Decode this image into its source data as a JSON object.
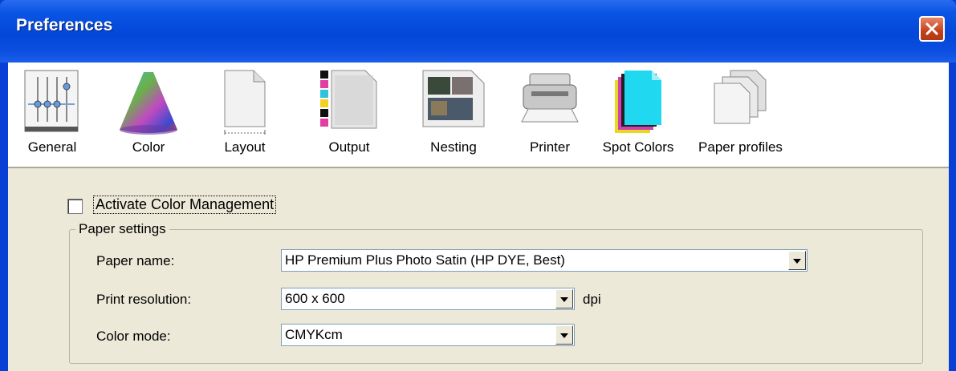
{
  "window": {
    "title": "Preferences"
  },
  "toolbar": {
    "items": [
      {
        "label": "General",
        "icon": "sliders-icon"
      },
      {
        "label": "Color",
        "icon": "color-cone-icon"
      },
      {
        "label": "Layout",
        "icon": "page-layout-icon"
      },
      {
        "label": "Output",
        "icon": "output-strip-icon"
      },
      {
        "label": "Nesting",
        "icon": "nesting-photos-icon"
      },
      {
        "label": "Printer",
        "icon": "printer-icon"
      },
      {
        "label": "Spot Colors",
        "icon": "spot-colors-icon"
      },
      {
        "label": "Paper profiles",
        "icon": "paper-stack-icon"
      }
    ]
  },
  "color": {
    "activate_label": "Activate Color Management",
    "activate_checked": false,
    "paper_settings": {
      "title": "Paper settings",
      "paper_name_label": "Paper name:",
      "paper_name_value": "HP Premium Plus Photo Satin (HP DYE, Best)",
      "resolution_label": "Print resolution:",
      "resolution_value": "600 x 600",
      "resolution_unit": "dpi",
      "color_mode_label": "Color mode:",
      "color_mode_value": "CMYKcm"
    }
  },
  "colors": {
    "titlebar": "#0347d9",
    "dialog_bg": "#ece9d8",
    "close_btn": "#c2421c"
  }
}
